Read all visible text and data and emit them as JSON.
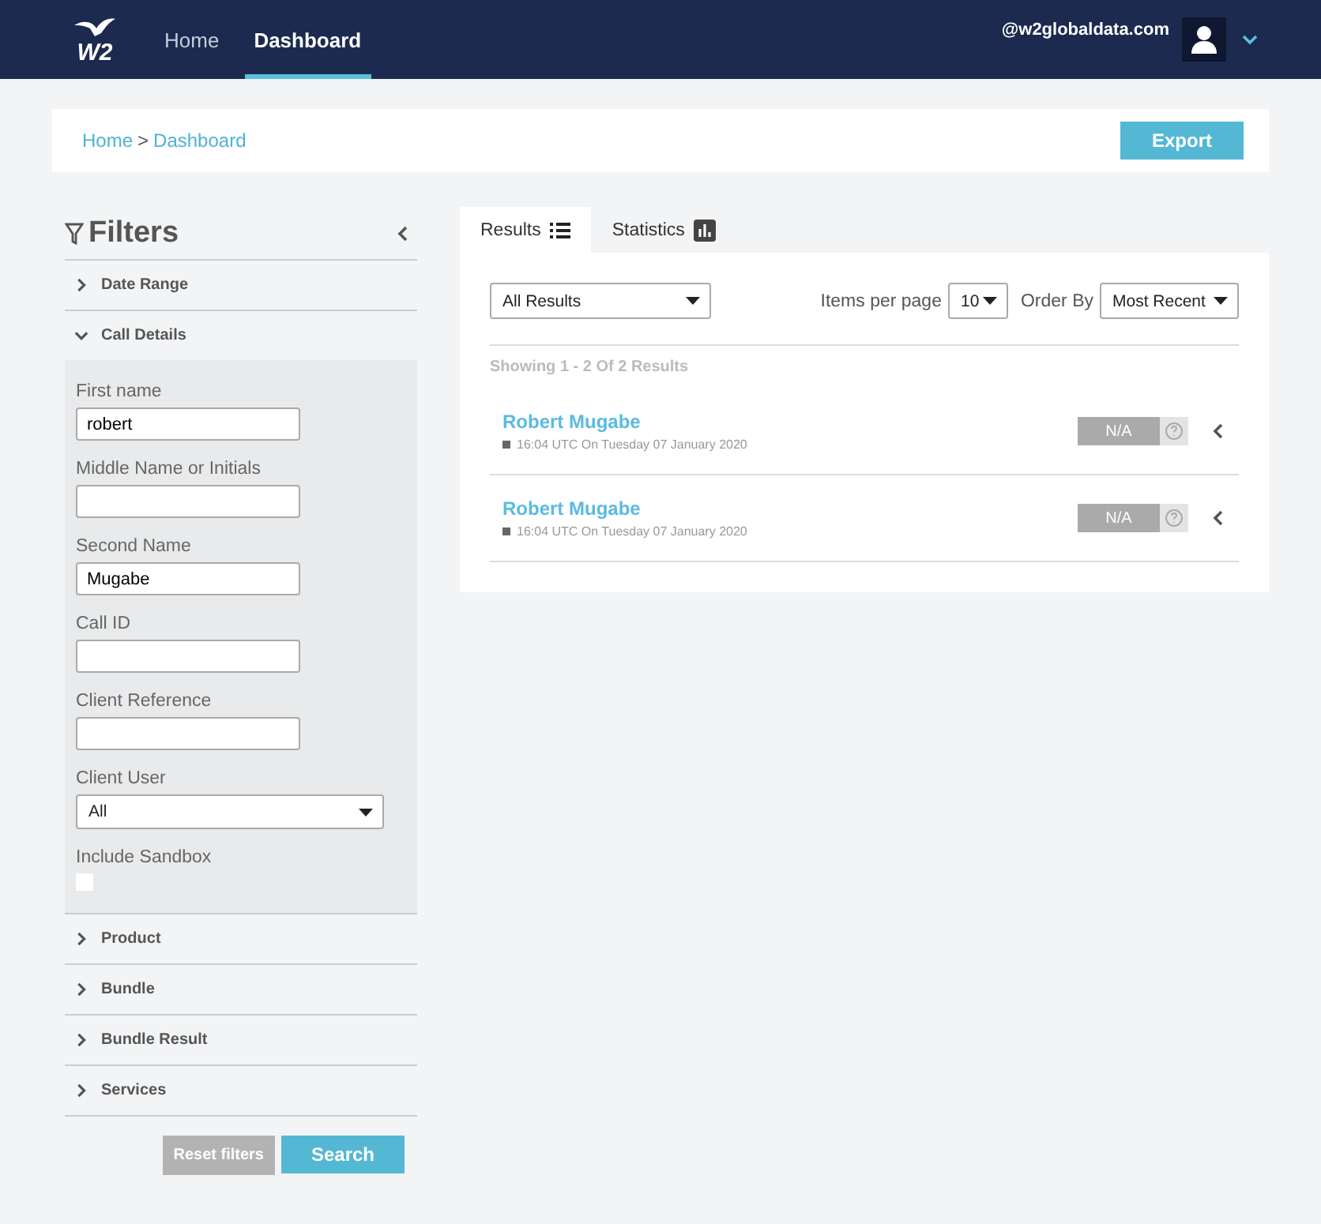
{
  "nav": {
    "logo": "W2",
    "links": [
      {
        "label": "Home",
        "selected": false
      },
      {
        "label": "Dashboard",
        "selected": true
      }
    ],
    "user": "@w2globaldata.com"
  },
  "breadcrumb": [
    "Home",
    "Dashboard"
  ],
  "breadcrumb_separator": ">",
  "export_button": "Export",
  "filters": {
    "title": "Filters",
    "sections": [
      {
        "label": "Date Range",
        "expanded": false
      },
      {
        "label": "Call Details",
        "expanded": true,
        "fields": [
          {
            "kind": "text",
            "label": "First name",
            "value": "robert"
          },
          {
            "kind": "text",
            "label": "Middle Name or Initials"
          },
          {
            "kind": "text",
            "label": "Second Name",
            "value": "Mugabe"
          },
          {
            "kind": "text",
            "label": "Call ID"
          },
          {
            "kind": "text",
            "label": "Client Reference"
          },
          {
            "kind": "select",
            "label": "Client User",
            "value": "All"
          },
          {
            "kind": "checkbox",
            "label": "Include Sandbox",
            "checked": false
          }
        ]
      },
      {
        "label": "Product",
        "expanded": false
      },
      {
        "label": "Bundle",
        "expanded": false
      },
      {
        "label": "Bundle Result",
        "expanded": false
      },
      {
        "label": "Services",
        "expanded": false
      }
    ],
    "reset_button": "Reset filters",
    "search_button": "Search"
  },
  "tabs": [
    {
      "label": "Results",
      "kind": "list",
      "selected": true
    },
    {
      "label": "Statistics",
      "kind": "chart",
      "selected": false
    }
  ],
  "results": {
    "filter": "All Results",
    "items_per_page_label": "Items per page",
    "items_per_page": "10",
    "order_by_label": "Order By",
    "order_by": "Most Recent",
    "summary": "Showing 1 - 2 Of 2 Results",
    "rows": [
      {
        "name": "Robert Mugabe",
        "time": "16:04 UTC On Tuesday 07 January 2020",
        "status": "N/A"
      },
      {
        "name": "Robert Mugabe",
        "time": "16:04 UTC On Tuesday 07 January 2020",
        "status": "N/A"
      }
    ]
  }
}
